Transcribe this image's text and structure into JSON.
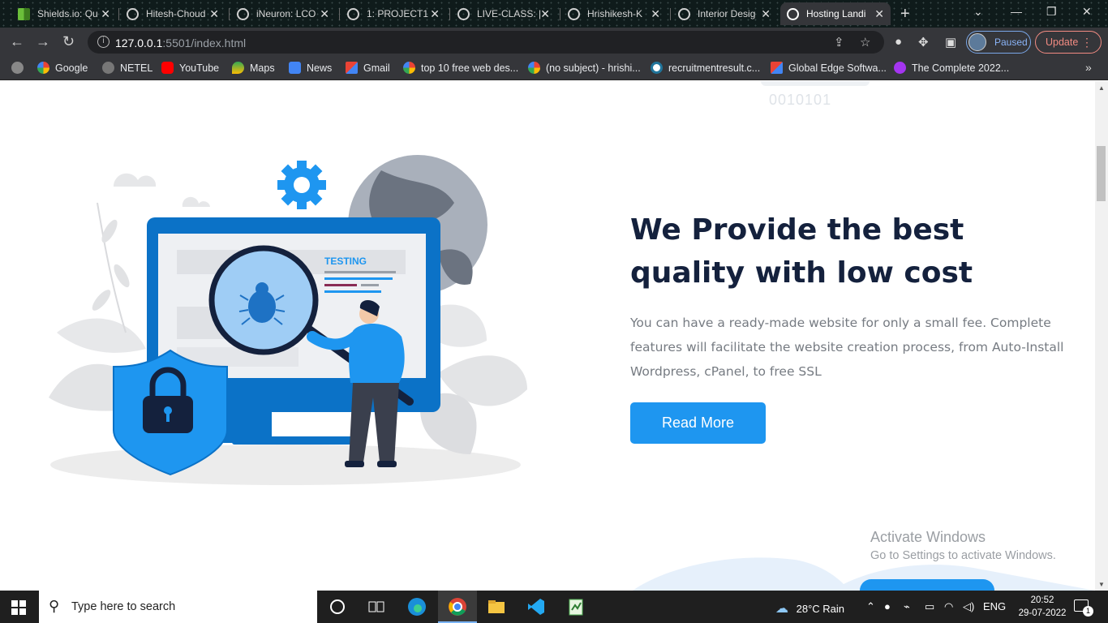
{
  "browser": {
    "tabs": [
      {
        "title": "Shields.io: Qu",
        "favicon": "shields-icon"
      },
      {
        "title": "Hitesh-Choud",
        "favicon": "globe-icon"
      },
      {
        "title": "iNeuron: LCO",
        "favicon": "globe-icon"
      },
      {
        "title": "1: PROJECT1",
        "favicon": "globe-icon"
      },
      {
        "title": "LIVE-CLASS: |",
        "favicon": "globe-icon"
      },
      {
        "title": "Hrishikesh-K",
        "favicon": "globe-icon"
      },
      {
        "title": "Interior Desig",
        "favicon": "globe-icon"
      },
      {
        "title": "Hosting Landi",
        "favicon": "globe-icon",
        "active": true
      }
    ],
    "url_host": "127.0.0.1",
    "url_rest": ":5501/index.html",
    "profile_status": "Paused",
    "update_label": "Update",
    "bookmarks": [
      {
        "label": "Google",
        "icon": "google-icon"
      },
      {
        "label": "NETEL",
        "icon": "globe-icon"
      },
      {
        "label": "YouTube",
        "icon": "youtube-icon"
      },
      {
        "label": "Maps",
        "icon": "maps-icon"
      },
      {
        "label": "News",
        "icon": "news-icon"
      },
      {
        "label": "Gmail",
        "icon": "gmail-icon"
      },
      {
        "label": "top 10 free web des...",
        "icon": "google-icon"
      },
      {
        "label": "(no subject) - hrishi...",
        "icon": "google-icon"
      },
      {
        "label": "recruitmentresult.c...",
        "icon": "wordpress-icon"
      },
      {
        "label": "Global Edge Softwa...",
        "icon": "gmail-icon"
      },
      {
        "label": "The Complete 2022...",
        "icon": "udemy-icon"
      }
    ]
  },
  "page": {
    "binary_text": "0010101",
    "headline": "We Provide the best quality with low cost",
    "description": "You can have a ready-made website for only a small fee. Complete features will facilitate the website creation process, from Auto-Install Wordpress, cPanel, to free SSL",
    "cta_label": "Read More",
    "illustration_label": "TESTING",
    "accent_color": "#1e96f0",
    "heading_color": "#14213d"
  },
  "os": {
    "activate_title": "Activate Windows",
    "activate_sub": "Go to Settings to activate Windows.",
    "search_placeholder": "Type here to search",
    "weather": "28°C  Rain",
    "language": "ENG",
    "time": "20:52",
    "date": "29-07-2022",
    "notification_count": "1"
  }
}
